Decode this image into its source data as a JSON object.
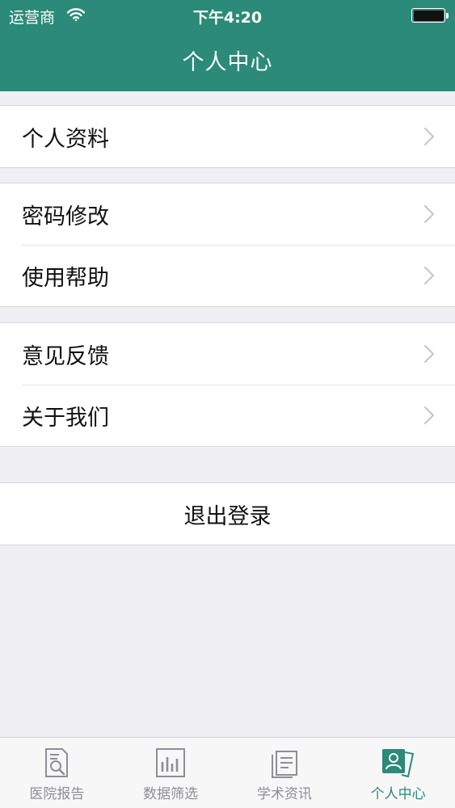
{
  "status_bar": {
    "carrier": "运营商",
    "time": "下午4:20"
  },
  "header": {
    "title": "个人中心"
  },
  "menu_groups": [
    {
      "items": [
        {
          "label": "个人资料"
        }
      ]
    },
    {
      "items": [
        {
          "label": "密码修改"
        },
        {
          "label": "使用帮助"
        }
      ]
    },
    {
      "items": [
        {
          "label": "意见反馈"
        },
        {
          "label": "关于我们"
        }
      ]
    }
  ],
  "logout": {
    "label": "退出登录"
  },
  "tabbar": {
    "active_index": 3,
    "tabs": [
      {
        "label": "医院报告",
        "icon": "report-search-icon"
      },
      {
        "label": "数据筛选",
        "icon": "bar-chart-icon"
      },
      {
        "label": "学术资讯",
        "icon": "document-icon"
      },
      {
        "label": "个人中心",
        "icon": "user-card-icon"
      }
    ]
  },
  "colors": {
    "primary": "#2c8a78",
    "background": "#efeff4",
    "tab_inactive": "#8e8e93"
  }
}
